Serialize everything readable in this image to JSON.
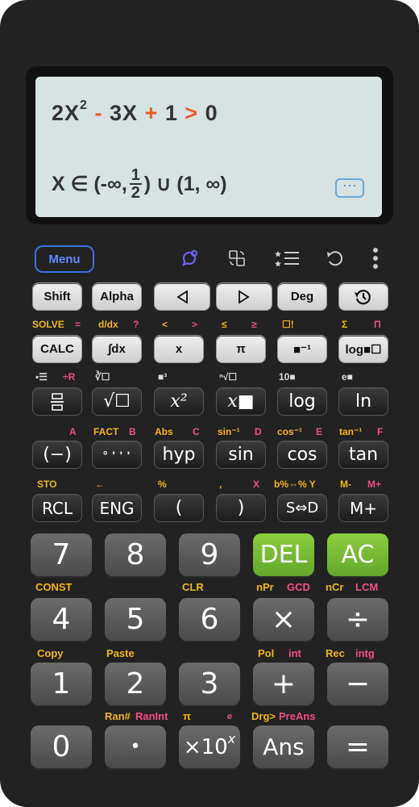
{
  "display": {
    "expr": {
      "t1": "2X",
      "sup": "2",
      "minus": "-",
      "t2": "3X",
      "plus": "+",
      "t3": "1",
      "gt": ">",
      "t4": "0"
    },
    "result": {
      "pre": "X ∈ (-∞,",
      "num": "1",
      "den": "2",
      "post": ") ∪ (1, ∞)"
    },
    "more": "···"
  },
  "toolbar": {
    "menu": "Menu"
  },
  "row1": {
    "shift": "Shift",
    "alpha": "Alpha",
    "deg": "Deg"
  },
  "row1_labels": {
    "solve": "SOLVE",
    "solve_eq": "=",
    "ddx": "d/dx",
    "q": "?",
    "lt": "<",
    "gt": ">",
    "le": "≤",
    "ge": "≥",
    "box": "☐!",
    "sigma": "Σ",
    "pi_prod": "Π"
  },
  "row2": {
    "calc": "CALC",
    "int": "∫dx",
    "x": "x",
    "pi": "π",
    "inv": "■⁻¹",
    "log": "log■☐"
  },
  "row2_labels": {
    "frac": "÷R",
    "cube": "∛☐",
    "pow3": "■³",
    "root": "ⁿ√☐",
    "ten": "10■",
    "e": "e■"
  },
  "row3": {
    "sqrt": "√☐",
    "x2": "x²",
    "xn": "x■",
    "log": "log",
    "ln": "ln"
  },
  "row3_labels": {
    "a": "A",
    "fact": "FACT",
    "b": "B",
    "abs": "Abs",
    "c": "C",
    "sin_inv": "sin⁻¹",
    "d": "D",
    "cos_inv": "cos⁻¹",
    "e": "E",
    "tan_inv": "tan⁻¹",
    "f": "F"
  },
  "row4": {
    "neg": "(−)",
    "dms": "° ' ' '",
    "hyp": "hyp",
    "sin": "sin",
    "cos": "cos",
    "tan": "tan"
  },
  "row4_labels": {
    "sto": "STO",
    "arrow": "←",
    "pct": "%",
    "comma": ",",
    "x": "X",
    "conv": "b%⇔% Y",
    "mminus": "M-",
    "mplus": "M+"
  },
  "row5": {
    "rcl": "RCL",
    "eng": "ENG",
    "lp": "(",
    "rp": ")",
    "sd": "S⇔D",
    "mp": "M+"
  },
  "num1": {
    "k7": "7",
    "k8": "8",
    "k9": "9",
    "del": "DEL",
    "ac": "AC"
  },
  "num1_labels": {
    "const": "CONST",
    "clr": "CLR",
    "npr": "nPr",
    "gcd": "GCD",
    "ncr": "nCr",
    "lcm": "LCM"
  },
  "num2": {
    "k4": "4",
    "k5": "5",
    "k6": "6",
    "mul": "×",
    "div": "÷"
  },
  "num2_labels": {
    "copy": "Copy",
    "paste": "Paste",
    "pol": "Pol",
    "int": "int",
    "rec": "Rec",
    "intg": "intg"
  },
  "num3": {
    "k1": "1",
    "k2": "2",
    "k3": "3",
    "add": "+",
    "sub": "−"
  },
  "num3_labels": {
    "ran": "Ran#",
    "ranint": "RanInt",
    "pi": "π",
    "e": "e",
    "drg": "Drg>",
    "preans": "PreAns"
  },
  "num4": {
    "k0": "0",
    "dot": "•",
    "exp": "×10",
    "ans": "Ans",
    "eq": "="
  }
}
